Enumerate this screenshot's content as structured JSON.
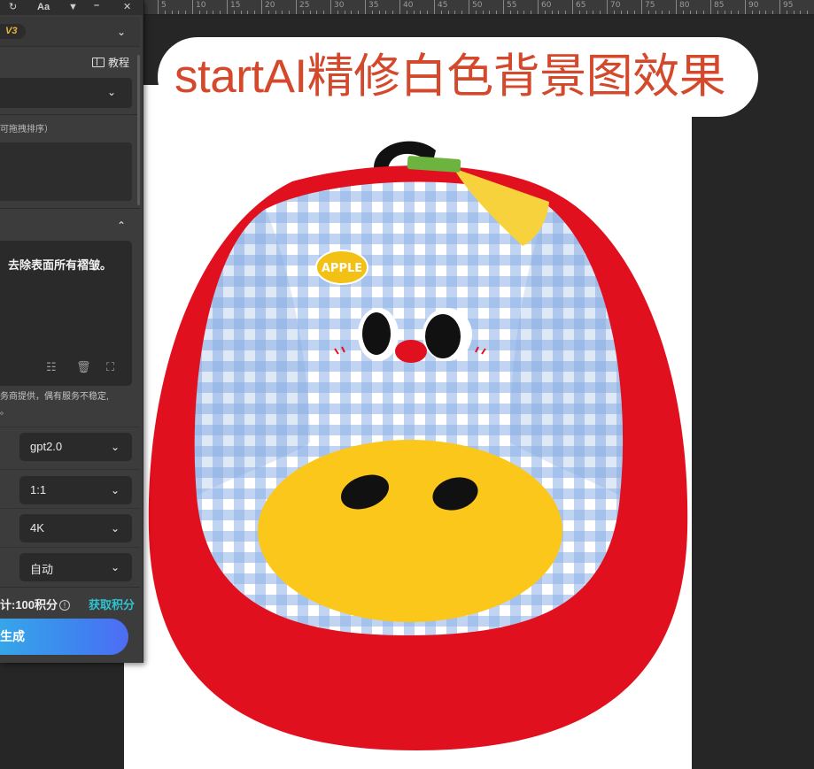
{
  "panel": {
    "version_badge": "V3",
    "tutorial_label": "教程",
    "upload_hint": "可拖拽排序）",
    "prompt_text": "去除表面所有褶皱。",
    "notice_line1": "务商提供，偶有服务不稳定,",
    "notice_line2": "。",
    "fields": [
      {
        "value": "gpt2.0"
      },
      {
        "value": "1:1"
      },
      {
        "value": "4K"
      },
      {
        "value": "自动"
      }
    ],
    "cost_text": "计:100积分",
    "get_points_label": "获取积分",
    "generate_label": "生成"
  },
  "titlebar": {
    "font_label": "Aa"
  },
  "canvas": {
    "headline": "startAI精修白色背景图效果"
  },
  "ruler": {
    "labels": [
      "5",
      "10",
      "15",
      "20",
      "25",
      "30",
      "35",
      "40",
      "45",
      "50",
      "55",
      "60",
      "65",
      "70",
      "75",
      "80",
      "85",
      "90",
      "95"
    ]
  },
  "colors": {
    "headline": "#d4482c",
    "accent_link": "#2fc2cf",
    "version_badge": "#e8b437",
    "chair_red": "#e0101e",
    "cushion_yellow": "#fbc71b",
    "gingham_blue": "#8db3e6"
  }
}
